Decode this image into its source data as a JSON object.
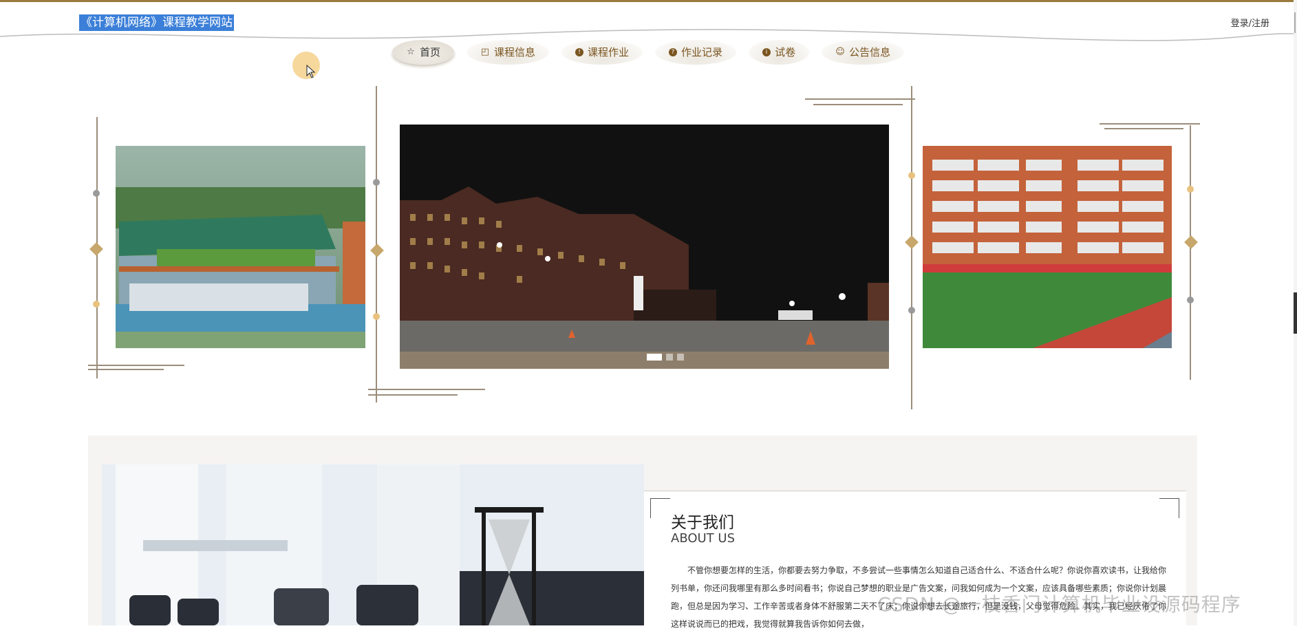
{
  "header": {
    "site_title": "《计算机网络》课程教学网站",
    "login_link": "登录/注册"
  },
  "nav": {
    "items": [
      {
        "label": "首页",
        "icon": "star-icon",
        "active": true
      },
      {
        "label": "课程信息",
        "icon": "bag-icon"
      },
      {
        "label": "课程作业",
        "icon": "info-dot-icon"
      },
      {
        "label": "作业记录",
        "icon": "question-dot-icon"
      },
      {
        "label": "试卷",
        "icon": "info-dot-icon"
      },
      {
        "label": "公告信息",
        "icon": "smile-icon"
      }
    ]
  },
  "carousel": {
    "slides": [
      "campus-aerial-photo",
      "campus-night-photo",
      "teaching-building-photo"
    ],
    "active_index": 0,
    "indicator_count": 3
  },
  "about": {
    "title": "关于我们",
    "subtitle": "ABOUT US",
    "text": "不管你想要怎样的生活，你都要去努力争取，不多尝试一些事情怎么知道自己适合什么、不适合什么呢？你说你喜欢读书，让我给你列书单，你还问我哪里有那么多时间看书；你说自己梦想的职业是广告文案，问我如何成为一个文案，应该具备哪些素质；你说你计划晨跑，但总是因为学习、工作辛苦或者身体不舒服第二天不了床；你说你想去长途旅行，但是没钱，父母觉得危险。其实，我已经厌倦了你这样说说而已的把戏，我觉得就算我告诉你如何去做，"
  },
  "watermark": "CSDN @一枝香门计算机毕业设源码程序",
  "colors": {
    "accent_gold": "#9a7a3e",
    "nav_text": "#7a5520",
    "title_highlight": "#3b7fd8"
  }
}
